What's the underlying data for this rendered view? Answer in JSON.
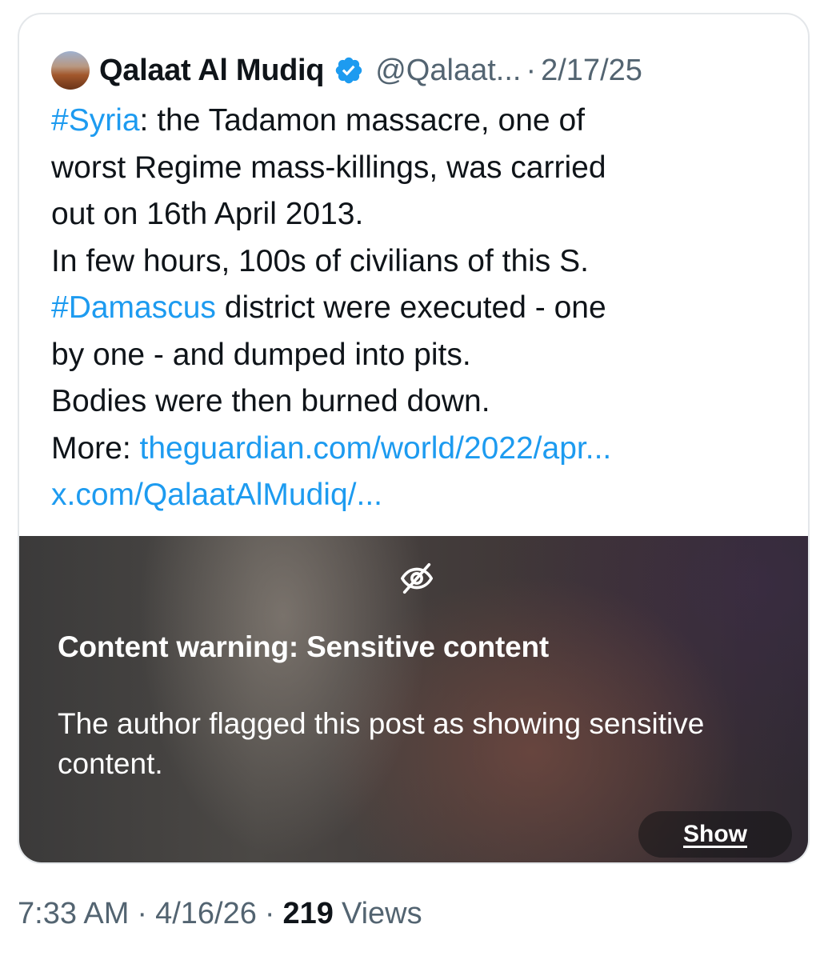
{
  "quoted_post": {
    "author_name": "Qalaat Al Mudiq",
    "handle": "@Qalaat...",
    "separator": "·",
    "date": "2/17/25",
    "verified_icon": "verified-badge-icon",
    "body": {
      "line1": {
        "hashtag": "#Syria",
        "text": ": the Tadamon massacre, one of"
      },
      "line2": "worst Regime mass-killings, was carried",
      "line3": "out on 16th April 2013.",
      "line4": "In few hours, 100s of civilians of this S.",
      "line5": {
        "hashtag": "#Damascus",
        "text": " district were executed - one"
      },
      "line6": "by one - and dumped into pits.",
      "line7": "Bodies were then burned down.",
      "line8": {
        "label": "More: ",
        "link": "theguardian.com/world/2022/apr..."
      },
      "line9": {
        "link": "x.com/QalaatAlMudiq/..."
      }
    },
    "media_warning": {
      "icon": "eye-slash-icon",
      "title": "Content warning: Sensitive content",
      "description": "The author flagged this post as showing sensitive content.",
      "show_label": "Show"
    }
  },
  "post_meta": {
    "time": "7:33 AM",
    "separator": "·",
    "date": "4/16/26",
    "views_count": "219",
    "views_label": "Views"
  },
  "colors": {
    "link": "#1d9bf0",
    "secondary_text": "#536471",
    "primary_text": "#0f1419",
    "verified": "#1d9bf0"
  }
}
